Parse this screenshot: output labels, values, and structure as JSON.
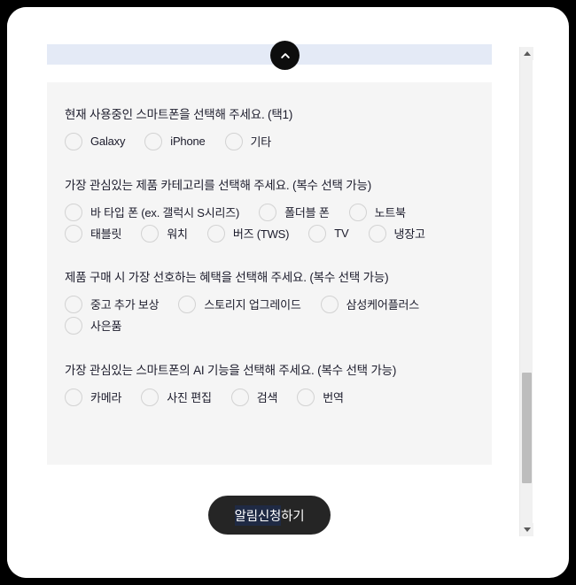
{
  "window": {
    "background_color": "#000000",
    "page_background": "#ffffff",
    "panel_background": "#f5f5f5",
    "selection_highlight_color": "#e4eaf6",
    "text_color": "#1b1b2b"
  },
  "collapse_button": {
    "icon": "chevron-up-icon",
    "background_color": "#0d0d0d"
  },
  "survey": {
    "questions": [
      {
        "title": "현재 사용중인 스마트폰을 선택해 주세요. (택1)",
        "rows": [
          [
            "Galaxy",
            "iPhone",
            "기타"
          ]
        ]
      },
      {
        "title": "가장 관심있는 제품 카테고리를 선택해 주세요. (복수 선택 가능)",
        "rows": [
          [
            "바 타입 폰 (ex. 갤럭시 S시리즈)",
            "폴더블 폰",
            "노트북"
          ],
          [
            "태블릿",
            "워치",
            "버즈 (TWS)",
            "TV",
            "냉장고"
          ]
        ]
      },
      {
        "title": "제품 구매 시 가장 선호하는 혜택을 선택해 주세요. (복수 선택 가능)",
        "rows": [
          [
            "중고 추가 보상",
            "스토리지 업그레이드",
            "삼성케어플러스"
          ],
          [
            "사은품"
          ]
        ]
      },
      {
        "title": "가장 관심있는 스마트폰의 AI 기능을 선택해 주세요. (복수 선택 가능)",
        "rows": [
          [
            "카메라",
            "사진 편집",
            "검색",
            "번역"
          ]
        ]
      }
    ]
  },
  "submit": {
    "label_selected": "알림신청",
    "label_rest": " 하기",
    "background_color": "#252525"
  },
  "scrollbar": {
    "up_icon": "triangle-up-icon",
    "down_icon": "triangle-down-icon",
    "track_color": "#f1f1f1",
    "thumb_color": "#bdbdbd"
  }
}
